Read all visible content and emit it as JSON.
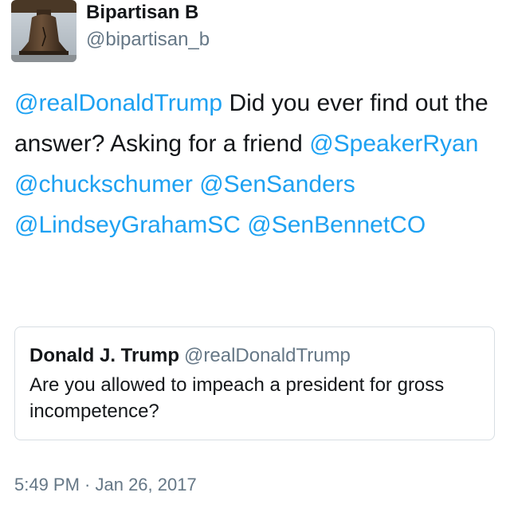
{
  "author": {
    "display_name": "Bipartisan B",
    "handle": "@bipartisan_b",
    "avatar_icon": "liberty-bell-icon"
  },
  "tweet": {
    "mention_1": "@realDonaldTrump",
    "text_1": " Did you ever find out the answer? Asking for a friend ",
    "mention_2": "@SpeakerRyan",
    "mention_3": "@chuckschumer",
    "mention_4": "@SenSanders",
    "mention_5": "@LindseyGrahamSC",
    "mention_6": "@SenBennetCO"
  },
  "quoted_tweet": {
    "display_name": "Donald J. Trump",
    "handle": "@realDonaldTrump",
    "text": "Are you allowed to impeach a president for gross incompetence?"
  },
  "timestamp": "5:49 PM · Jan 26, 2017",
  "colors": {
    "link": "#1da1f2",
    "text": "#14171a",
    "secondary": "#657786",
    "border": "#d8dee3"
  }
}
